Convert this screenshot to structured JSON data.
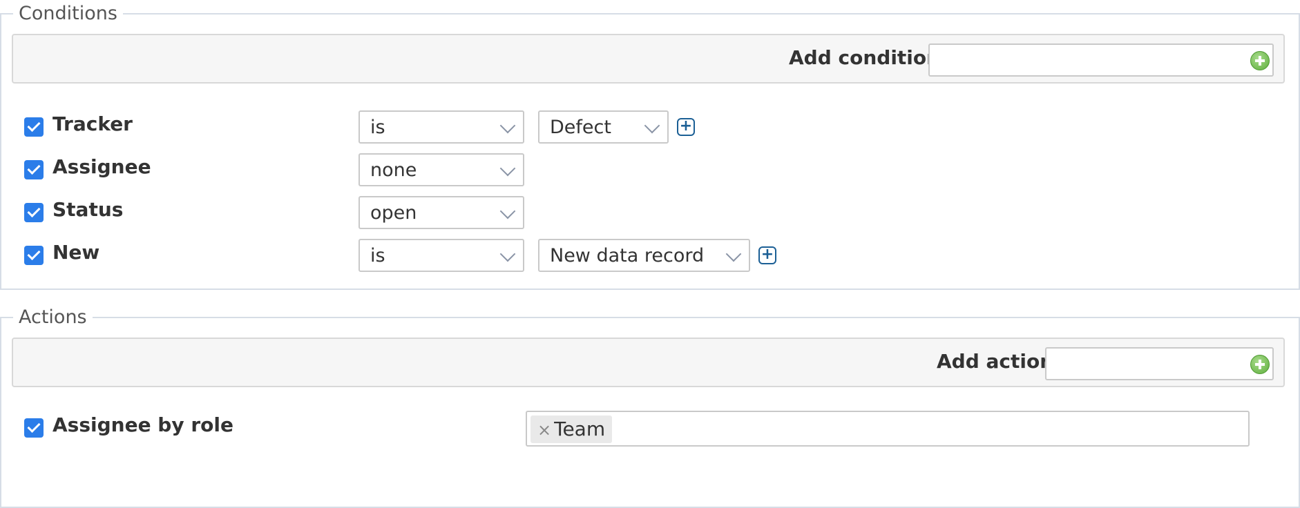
{
  "conditions": {
    "legend": "Conditions",
    "add_label": "Add condition",
    "add_value": "",
    "rows": [
      {
        "label": "Tracker",
        "checked": true,
        "operator": "is",
        "value": "Defect"
      },
      {
        "label": "Assignee",
        "checked": true,
        "operator": "none"
      },
      {
        "label": "Status",
        "checked": true,
        "operator": "open"
      },
      {
        "label": "New",
        "checked": true,
        "operator": "is",
        "value": "New data record"
      }
    ]
  },
  "actions": {
    "legend": "Actions",
    "add_label": "Add action",
    "add_value": "",
    "rows": [
      {
        "label": "Assignee by role",
        "checked": true,
        "tags": [
          "Team"
        ]
      }
    ]
  },
  "icons": {
    "add_green": "plus-circle-icon",
    "add_value": "plus-square-icon",
    "dropdown": "chevron-down-icon",
    "remove_tag": "×"
  },
  "colors": {
    "checkbox": "#2b7de9",
    "add_value_icon": "#1b5f95",
    "green_add": "#5fae3d"
  }
}
